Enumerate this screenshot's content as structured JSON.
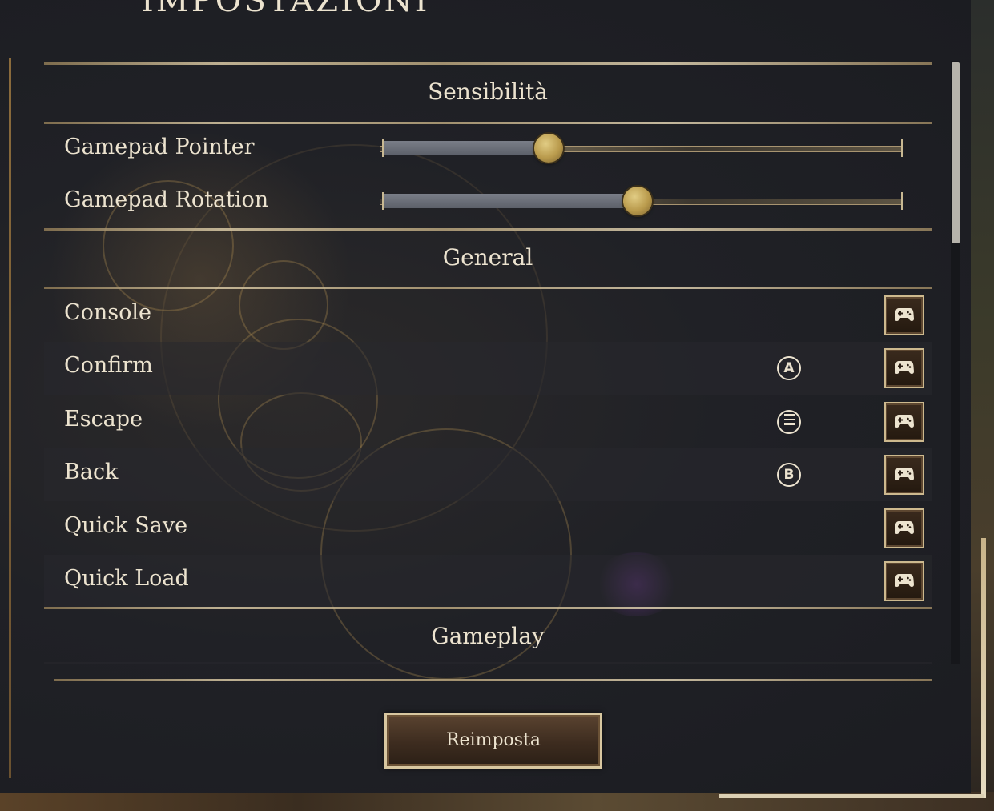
{
  "window": {
    "title": "IMPOSTAZIONI"
  },
  "sections": {
    "sensitivity": {
      "title": "Sensibilità",
      "sliders": [
        {
          "label": "Gamepad Pointer",
          "value_fraction": 0.32
        },
        {
          "label": "Gamepad Rotation",
          "value_fraction": 0.49
        }
      ]
    },
    "general": {
      "title": "General",
      "bindings": [
        {
          "label": "Console",
          "glyph": ""
        },
        {
          "label": "Confirm",
          "glyph": "A"
        },
        {
          "label": "Escape",
          "glyph": "menu"
        },
        {
          "label": "Back",
          "glyph": "B"
        },
        {
          "label": "Quick Save",
          "glyph": ""
        },
        {
          "label": "Quick Load",
          "glyph": ""
        }
      ]
    },
    "gameplay": {
      "title": "Gameplay"
    }
  },
  "footer": {
    "reset_label": "Reimposta"
  },
  "icons": {
    "rebind": "gamepad-icon",
    "glyph_a": "gamepad-a-button-icon",
    "glyph_b": "gamepad-b-button-icon",
    "glyph_menu": "gamepad-menu-button-icon"
  },
  "colors": {
    "text": "#ece3cf",
    "accent_gold": "#b99a4c",
    "frame": "#cdb98e",
    "panel_bg": "#1c1d22"
  }
}
